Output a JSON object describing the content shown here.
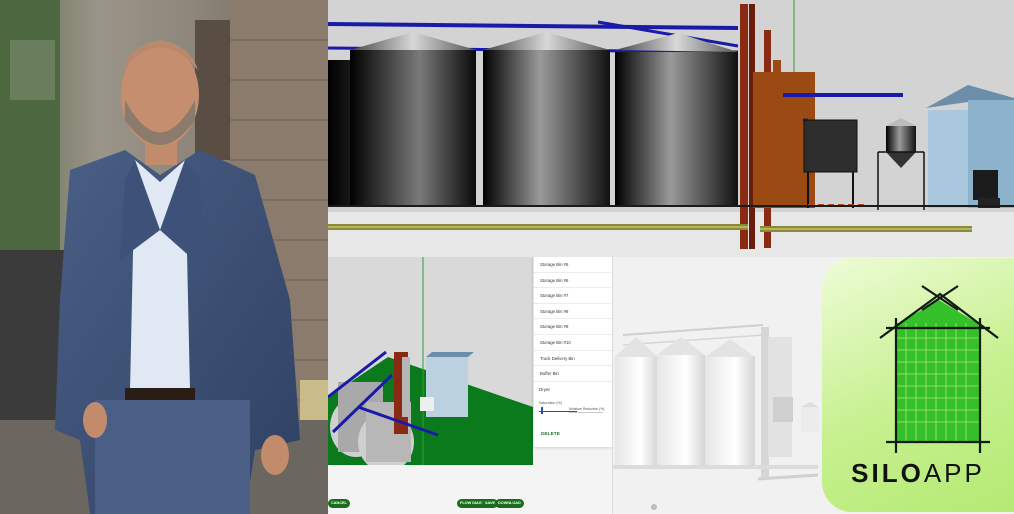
{
  "editor": {
    "bin_list": [
      "Storage Bin #5",
      "Storage Bin #6",
      "Storage Bin #7",
      "Storage Bin #8",
      "Storage Bin #9",
      "Storage Bin #10",
      "Truck Delivery Bin",
      "Buffer Bin"
    ],
    "dryer_label": "Dryer",
    "saturation_label": "Saturation (%)",
    "moisture_label": "Moisture Reduction (%)",
    "delete_label": "DELETE",
    "cancel_label": "CANCEL",
    "flow_diagram_label": "FLOW DIAGRAM",
    "save_label": "SAVE",
    "download_label": "DOWNLOAD"
  },
  "logo": {
    "text_dark": "SILO",
    "text_light": "APP"
  },
  "colors": {
    "logo_green": "#34c028",
    "button_green": "#1a6d1a",
    "ground_green": "#0b7a1d",
    "pipe_blue": "#1a1aa8",
    "leg_red": "#8b2a12",
    "tower_brown": "#9a4a12"
  }
}
